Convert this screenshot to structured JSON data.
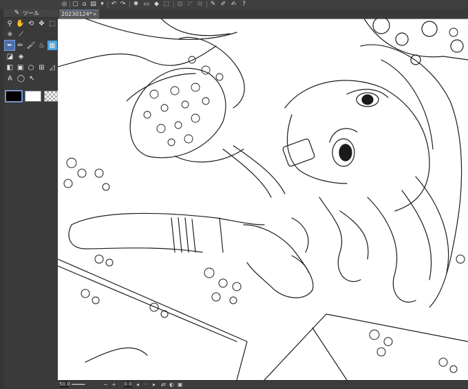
{
  "toolbar": {
    "icons": [
      "app-menu-icon",
      "new-file-icon",
      "open-icon",
      "save-icon",
      "shelf-icon",
      "dropdown-icon",
      "undo-icon",
      "redo-icon",
      "loading-icon",
      "clear-icon",
      "fill-icon",
      "transform-icon",
      "deselect-icon",
      "lasso-icon",
      "crop-icon",
      "pen-stroke-icon",
      "brush-stroke-icon",
      "smudge-icon",
      "help-icon"
    ]
  },
  "tool_panel": {
    "title": "ツール",
    "tools": [
      [
        "zoom-tool",
        "hand-tool",
        "rotate-tool",
        "move-tool",
        "select-rect-tool"
      ],
      [
        "magic-wand-tool",
        "eyedropper-tool"
      ],
      [
        "pen-tool",
        "pencil-tool",
        "brush-tool",
        "airbrush-tool",
        "decoration-tool"
      ],
      [
        "eraser-tool",
        "fill-tool"
      ],
      [
        "gradient-tool",
        "figure-tool",
        "ellipse-tool",
        "frame-tool",
        "ruler-tool"
      ],
      [
        "text-tool",
        "balloon-tool",
        "correct-line-tool"
      ]
    ],
    "selected_tool": "pen-tool",
    "colors": {
      "main": "#000000",
      "sub": "#ffffff"
    }
  },
  "document": {
    "tab_title": "20230124*",
    "close": "×"
  },
  "status": {
    "zoom": "50.0",
    "angle": "0.0"
  },
  "canvas": {
    "description_color": "#ffffff",
    "line_color": "#1a1a1a"
  }
}
